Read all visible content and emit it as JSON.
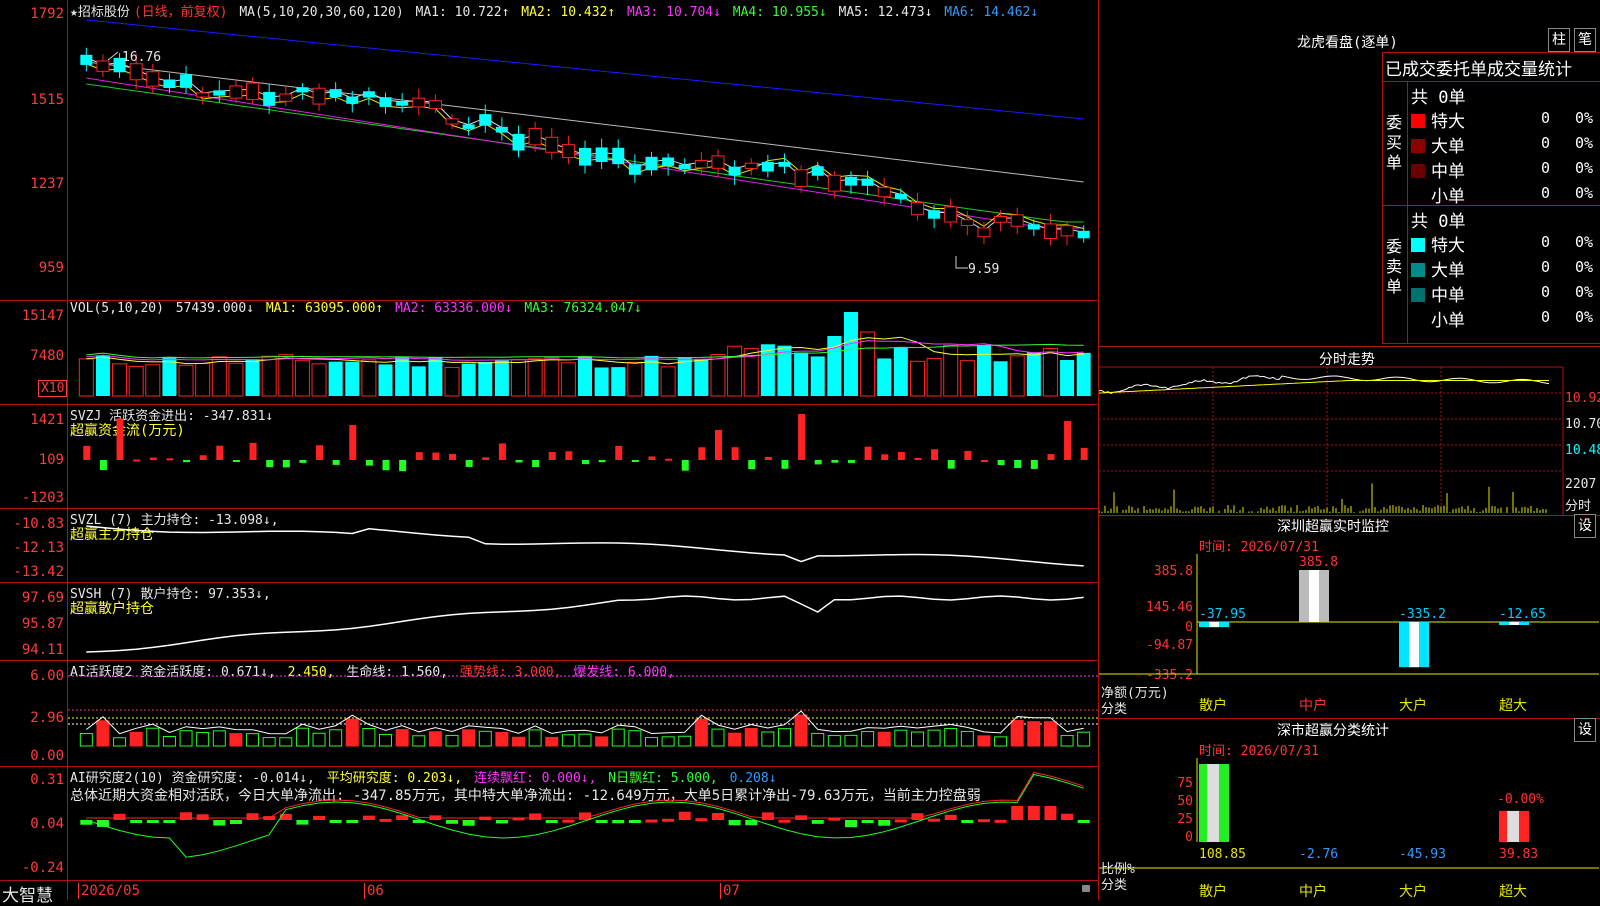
{
  "kline": {
    "title": "★招标股份",
    "mode": "(日线，前复权)",
    "ma_label": "MA(5,10,20,30,60,120)",
    "ma": [
      {
        "label": "MA1: 10.722↑",
        "color": "#e6e6e6"
      },
      {
        "label": "MA2: 10.432↑",
        "color": "#ffff33"
      },
      {
        "label": "MA3: 10.704↓",
        "color": "#ff33ff"
      },
      {
        "label": "MA4: 10.955↓",
        "color": "#33ff33"
      },
      {
        "label": "MA5: 12.473↓",
        "color": "#e6e6e6"
      },
      {
        "label": "MA6: 14.462↓",
        "color": "#3366ff"
      }
    ],
    "y_ticks": [
      "1792",
      "1515",
      "1237",
      "959"
    ],
    "high_mark": "16.76",
    "low_mark": "9.59"
  },
  "vol": {
    "label": "VOL(5,10,20)",
    "value": "57439.000↓",
    "ma": [
      "MA1: 63095.000↑",
      "MA2: 63336.000↓",
      "MA3: 76324.047↓"
    ],
    "y_ticks": [
      "15147",
      "7480"
    ],
    "unit": "X10"
  },
  "svzj": {
    "label": "SVZJ  活跃资金进出: -347.831↓",
    "sub": "超赢资金流(万元)",
    "y_ticks": [
      "1421",
      "109",
      "-1203"
    ]
  },
  "svzl": {
    "label": "SVZL (7) 主力持仓: -13.098↓,",
    "sub": "超赢主力持仓",
    "y_ticks": [
      "-10.83",
      "-12.13",
      "-13.42"
    ]
  },
  "svsh": {
    "label": "SVSH (7) 散户持仓: 97.353↓,",
    "sub": "超赢散户持仓",
    "y_ticks": [
      "97.69",
      "95.87",
      "94.11"
    ]
  },
  "ai1": {
    "parts": [
      {
        "t": "AI活跃度2 资金活跃度: 0.671↓,",
        "c": "#e6e6e6"
      },
      {
        "t": "2.450,",
        "c": "#ffff33"
      },
      {
        "t": "生命线: 1.560,",
        "c": "#e6e6e6"
      },
      {
        "t": "强势线: 3.000,",
        "c": "#ff3333"
      },
      {
        "t": "爆发线: 6.000,",
        "c": "#ff33ff"
      }
    ],
    "y_ticks": [
      "6.00",
      "2.96",
      "0.00"
    ]
  },
  "ai2": {
    "parts": [
      {
        "t": "AI研究度2(10) 资金研究度: -0.014↓,",
        "c": "#e6e6e6"
      },
      {
        "t": "平均研究度: 0.203↓,",
        "c": "#ffff33"
      },
      {
        "t": "连续飘红: 0.000↓,",
        "c": "#ff33ff"
      },
      {
        "t": "N日飘红: 5.000,",
        "c": "#33ff33"
      },
      {
        "t": "0.208↓",
        "c": "#3399ff"
      }
    ],
    "summary": "总体近期大资金相对活跃，今日大单净流出: -347.85万元，其中特大单净流出: -12.649万元，大单5日累计净出-79.63万元，当前主力控盘弱",
    "y_ticks": [
      "0.31",
      "0.04",
      "-0.24"
    ]
  },
  "bottom": {
    "brand": "大智慧",
    "dates": [
      "2026/05",
      "06",
      "07"
    ]
  },
  "right": {
    "lhb_title": "龙虎看盘(逐单)",
    "btn1": "柱",
    "btn2": "笔",
    "stats_title": "已成交委托单成交量统计",
    "buy_label": "委买单",
    "sell_label": "委卖单",
    "buy_total": "共 0单",
    "sell_total": "共 0单",
    "buy_rows": [
      {
        "name": "特大",
        "n": "0",
        "p": "0%",
        "color": "#ff0000"
      },
      {
        "name": "大单",
        "n": "0",
        "p": "0%",
        "color": "#8b0000"
      },
      {
        "name": "中单",
        "n": "0",
        "p": "0%",
        "color": "#6b0000"
      },
      {
        "name": "小单",
        "n": "0",
        "p": "0%",
        "color": ""
      }
    ],
    "sell_rows": [
      {
        "name": "特大",
        "n": "0",
        "p": "0%",
        "color": "#00ffff"
      },
      {
        "name": "大单",
        "n": "0",
        "p": "0%",
        "color": "#008b8b"
      },
      {
        "name": "中单",
        "n": "0",
        "p": "0%",
        "color": "#007070"
      },
      {
        "name": "小单",
        "n": "0",
        "p": "0%",
        "color": ""
      }
    ],
    "fs_title": "分时走势",
    "fs_ticks": [
      "10.92",
      "10.70",
      "10.48"
    ],
    "fs_vol": "2207",
    "fs_vol_label": "分时",
    "sz_title": "深圳超赢实时监控",
    "sz_set": "设",
    "sz_time": "时间: 2026/07/31",
    "sz_ticks": [
      "385.8",
      "145.46",
      "0",
      "-94.87",
      "-335.2"
    ],
    "sz_values": [
      "-37.95",
      "385.8",
      "-335.2",
      "-12.65"
    ],
    "sz_net": "净额(万元)",
    "sz_cat": "分类",
    "cats": [
      "散户",
      "中户",
      "大户",
      "超大"
    ],
    "cls_title": "深市超赢分类统计",
    "cls_set": "设",
    "cls_time": "时间: 2026/07/31",
    "cls_ticks": [
      "75",
      "50",
      "25",
      "0"
    ],
    "cls_values": [
      "108.85",
      "-2.76",
      "-45.93",
      "39.83"
    ],
    "cls_note": "-0.00%",
    "cls_ratio": "比例%",
    "cls_cat": "分类"
  }
}
